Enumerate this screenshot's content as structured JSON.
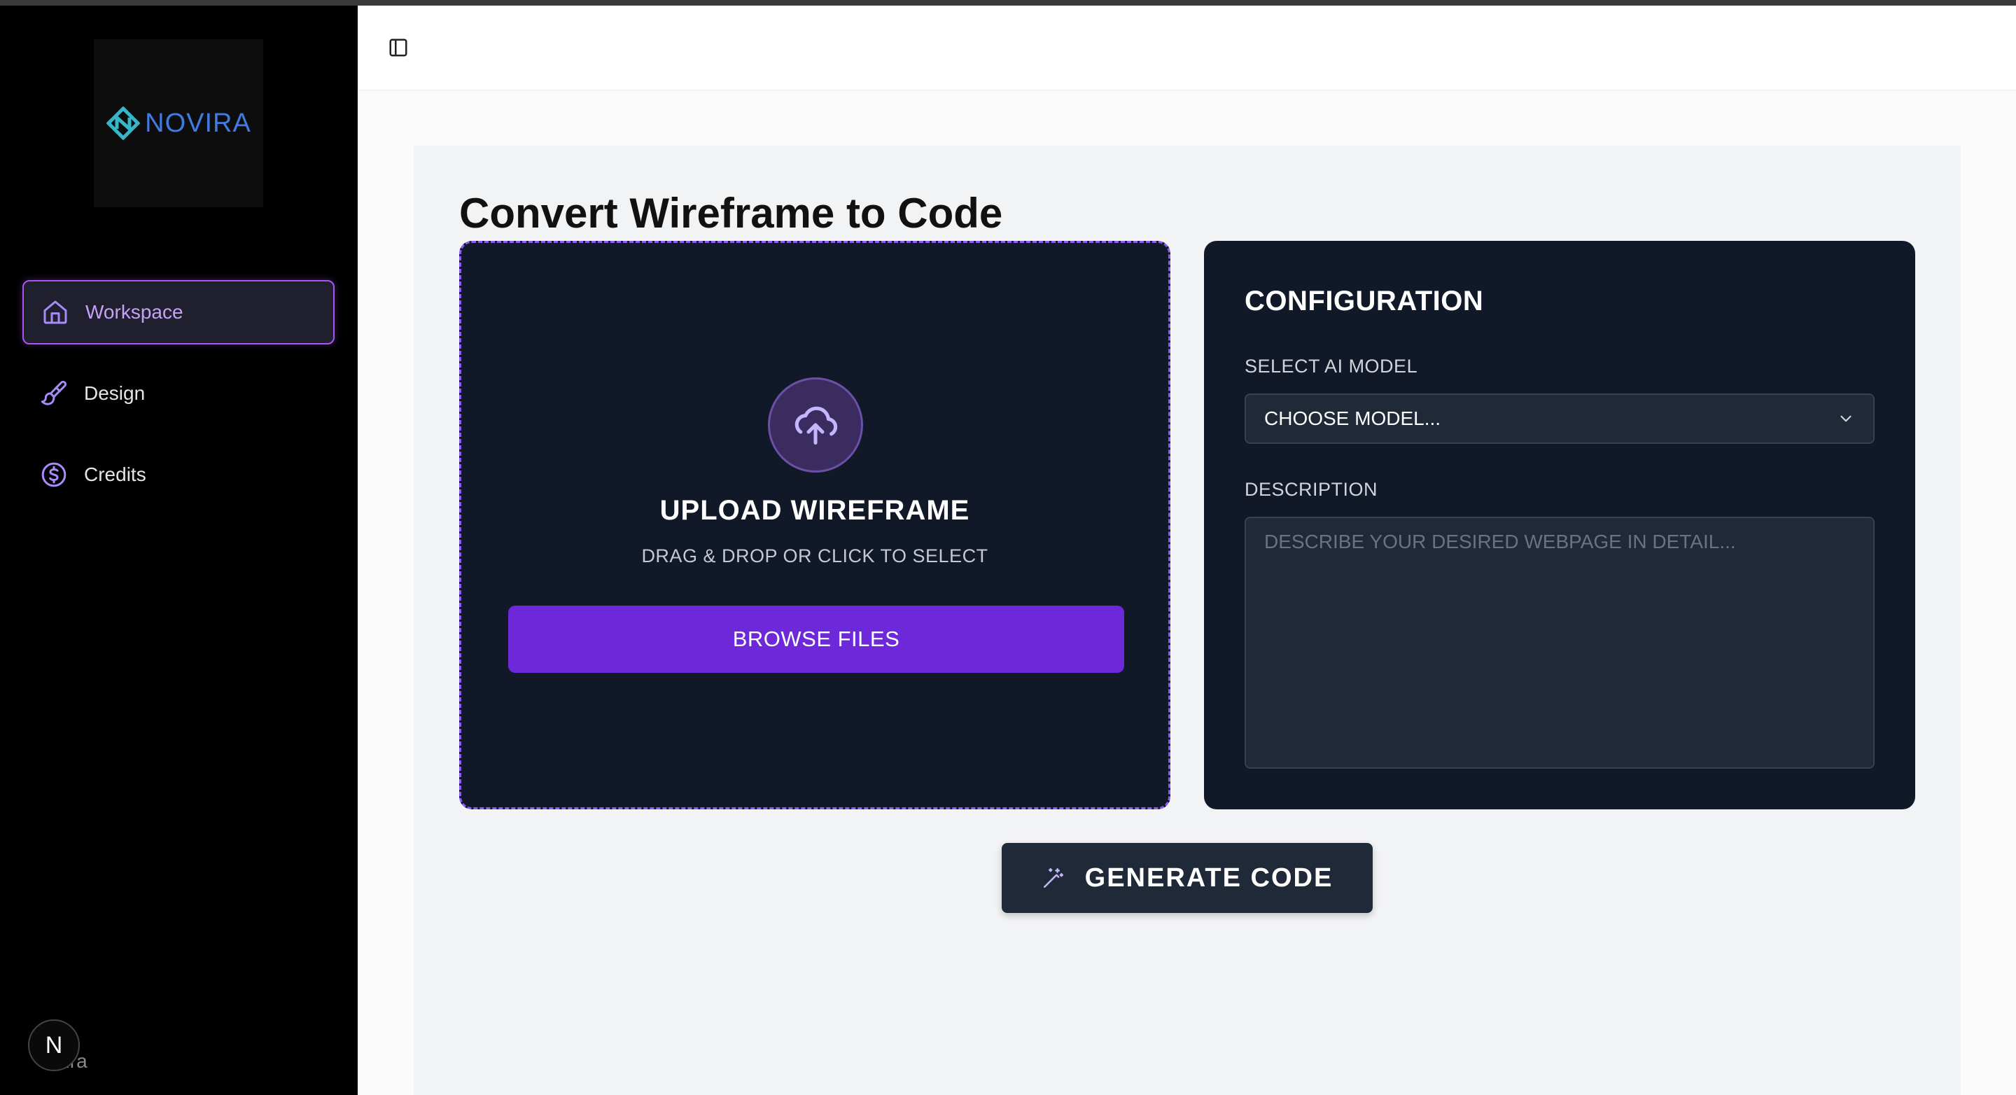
{
  "app": {
    "logo_text": "NOVIRA"
  },
  "sidebar": {
    "items": [
      {
        "label": "Workspace",
        "icon": "home-icon",
        "active": true
      },
      {
        "label": "Design",
        "icon": "paintbrush-icon",
        "active": false
      },
      {
        "label": "Credits",
        "icon": "dollar-circle-icon",
        "active": false
      }
    ],
    "footer_badge": "N",
    "footer_text": "ovira"
  },
  "header": {
    "toggle_icon": "sidebar-toggle-icon"
  },
  "main": {
    "title": "Convert Wireframe to Code",
    "upload": {
      "icon": "cloud-upload-icon",
      "title": "UPLOAD WIREFRAME",
      "subtitle": "DRAG & DROP OR CLICK TO SELECT",
      "button_label": "BROWSE FILES"
    },
    "config": {
      "title": "CONFIGURATION",
      "model_label": "SELECT AI MODEL",
      "model_value": "CHOOSE MODEL...",
      "description_label": "DESCRIPTION",
      "description_placeholder": "DESCRIBE YOUR DESIRED WEBPAGE IN DETAIL...",
      "description_value": ""
    },
    "generate_label": "GENERATE CODE",
    "generate_icon": "magic-wand-icon"
  },
  "colors": {
    "accent": "#6d28d9",
    "accent_light": "#a855f7",
    "card_bg": "#111827",
    "sidebar_bg": "#000000"
  }
}
